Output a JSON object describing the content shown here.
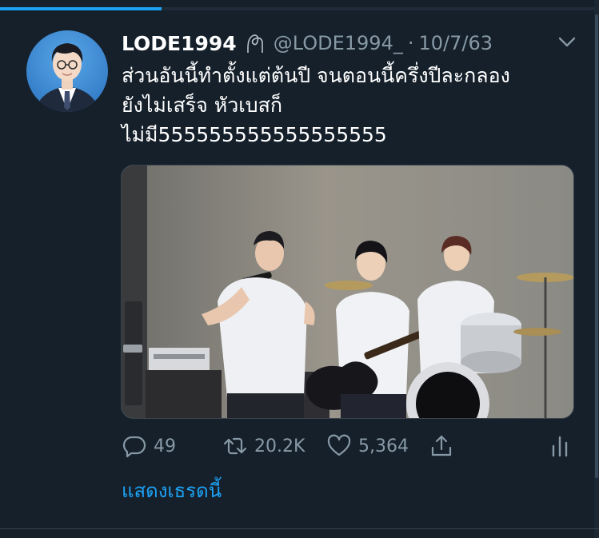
{
  "video_progress": 0.27,
  "tweet": {
    "display_name": "LODE1994",
    "handle": "@LODE1994_",
    "separator": "·",
    "timestamp": "10/7/63",
    "text_lines": [
      "ส่วนอันนี้ทำตั้งแต่ต้นปี จนตอนนี้ครึ่งปีละกลอง",
      "ยังไม่เสร็จ หัวเบสก็",
      "ไม่มี555555555555555555"
    ],
    "replies": "49",
    "retweets": "20.2K",
    "likes": "5,364",
    "show_thread": "แสดงเธรดนี้"
  },
  "colors": {
    "background": "#15202b",
    "secondary_text": "#8899a6",
    "accent": "#1da1f2",
    "border": "#38444d"
  },
  "icons": {
    "name_emoji": "seedling-like-glyph-icon",
    "menu": "chevron-down-icon",
    "reply": "reply-icon",
    "retweet": "retweet-icon",
    "like": "heart-icon",
    "share": "share-icon",
    "analytics": "analytics-icon"
  }
}
